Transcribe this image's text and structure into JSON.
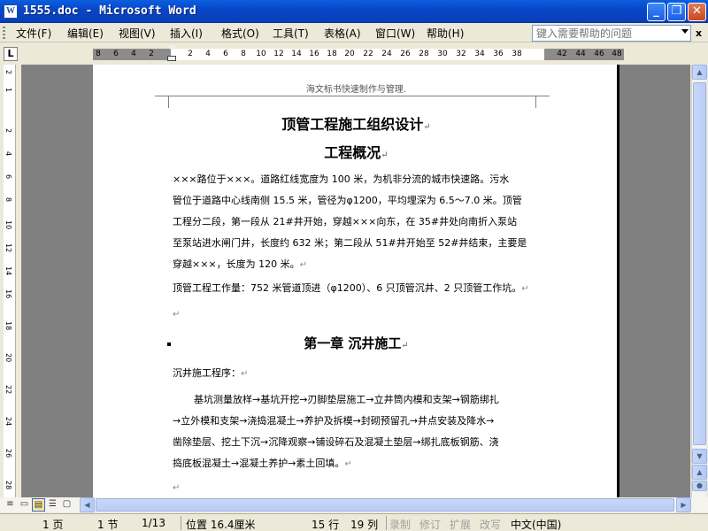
{
  "window": {
    "icon_letter": "W",
    "title": "1555.doc - Microsoft Word",
    "buttons": {
      "minimize": "_",
      "restore": "❐",
      "close": "✕"
    }
  },
  "menubar": {
    "items": [
      "文件(F)",
      "编辑(E)",
      "视图(V)",
      "插入(I)",
      "格式(O)",
      "工具(T)",
      "表格(A)",
      "窗口(W)",
      "帮助(H)"
    ],
    "help_placeholder": "键入需要帮助的问题",
    "close_glyph": "x"
  },
  "ruler": {
    "tab_selector": "L",
    "numbers": [
      "8",
      "6",
      "4",
      "2",
      "2",
      "4",
      "6",
      "8",
      "10",
      "12",
      "14",
      "16",
      "18",
      "20",
      "22",
      "24",
      "26",
      "28",
      "30",
      "32",
      "34",
      "36",
      "38",
      "42",
      "44",
      "46",
      "48"
    ],
    "vertical_numbers": [
      "2",
      "1",
      "2",
      "4",
      "6",
      "8",
      "10",
      "12",
      "14",
      "16",
      "18",
      "20",
      "22",
      "24",
      "26",
      "28"
    ]
  },
  "document": {
    "header": "海文标书快速制作与管理.",
    "title": "顶管工程施工组织设计",
    "subtitle": "工程概况",
    "para1": [
      "×××路位于×××。道路红线宽度为 100 米，为机非分流的城市快速路。污水",
      "管位于道路中心线南侧 15.5 米，管径为φ1200，平均埋深为 6.5～7.0 米。顶管",
      "工程分二段，第一段从 21#井开始，穿越×××向东，在 35#井处向南折入泵站",
      "至泵站进水闸门井，长度约 632 米；第二段从 51#井开始至 52#井结束，主要是",
      "穿越×××，长度为 120 米。"
    ],
    "para2": "顶管工程工作量：752 米管道顶进（φ1200）、6 只顶管沉井、2 只顶管工作坑。",
    "chapter1": "第一章 沉井施工",
    "procedure_label": "沉井施工程序：",
    "procedure": [
      "基坑测量放样→基坑开挖→刃脚垫层施工→立井筒内模和支架→钢筋绑扎",
      "→立外模和支架→浇捣混凝土→养护及拆模→封砌预留孔→井点安装及降水→",
      "凿除垫层、挖土下沉→沉降观察→铺设碎石及混凝土垫层→绑扎底板钢筋、浇",
      "捣底板混凝土→混凝土养护→素土回填。"
    ],
    "para_mark": "↵"
  },
  "statusbar": {
    "page": "1 页",
    "section": "1 节",
    "pages": "1/13",
    "position": "位置 16.4厘米",
    "line": "15 行",
    "column": "19 列",
    "rec": "录制",
    "trk": "修订",
    "ext": "扩展",
    "ovr": "改写",
    "language": "中文(中国)"
  }
}
